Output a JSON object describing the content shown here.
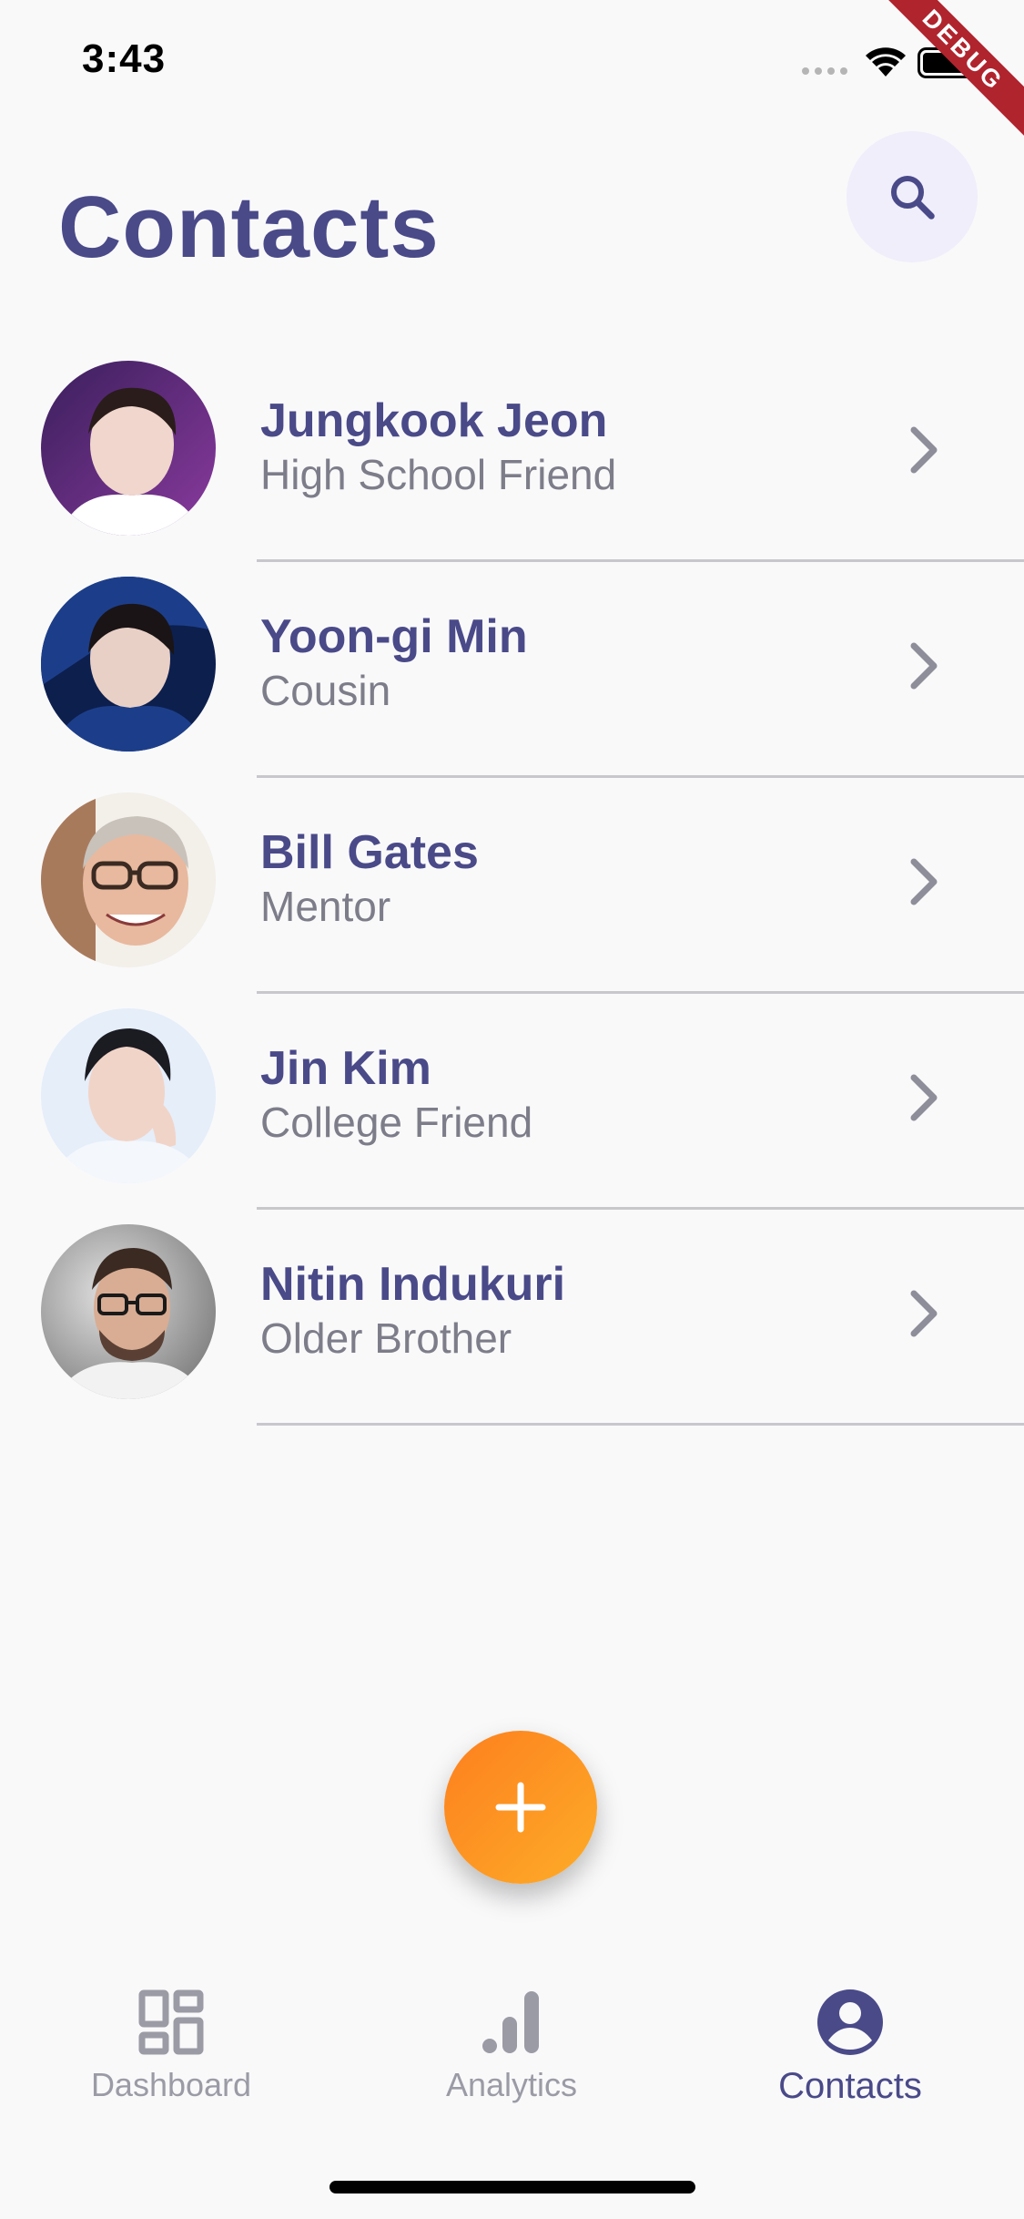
{
  "status_bar": {
    "time": "3:43"
  },
  "debug_banner": "DEBUG",
  "header": {
    "title": "Contacts",
    "search_icon": "search-icon"
  },
  "contacts": [
    {
      "name": "Jungkook Jeon",
      "relation": "High School Friend",
      "avatar_colors": [
        "#8a3a9e",
        "#f0d6cc",
        "#ffffff"
      ]
    },
    {
      "name": "Yoon-gi Min",
      "relation": "Cousin",
      "avatar_colors": [
        "#1c3e8a",
        "#e9d0c6",
        "#0d1f4d"
      ]
    },
    {
      "name": "Bill Gates",
      "relation": "Mentor",
      "avatar_colors": [
        "#a87a5c",
        "#e8b99e",
        "#f3efe9"
      ]
    },
    {
      "name": "Jin Kim",
      "relation": "College Friend",
      "avatar_colors": [
        "#e5eef9",
        "#f1d4c8",
        "#1b1b22"
      ]
    },
    {
      "name": "Nitin Indukuri",
      "relation": "Older Brother",
      "avatar_colors": [
        "#6e6e6e",
        "#d8ad94",
        "#3a2a22"
      ]
    }
  ],
  "fab": {
    "icon": "plus-icon",
    "colors": [
      "#fd7f1e",
      "#fdac28"
    ]
  },
  "bottom_nav": {
    "items": [
      {
        "label": "Dashboard",
        "icon": "dashboard-icon",
        "active": false
      },
      {
        "label": "Analytics",
        "icon": "analytics-icon",
        "active": false
      },
      {
        "label": "Contacts",
        "icon": "account-circle-icon",
        "active": true
      }
    ]
  },
  "colors": {
    "primary": "#4a4a89",
    "secondary_text": "#7d7d8a",
    "background": "#f9f9fa",
    "search_button_bg": "#efeefa",
    "inactive_nav": "#9b9ba6"
  }
}
